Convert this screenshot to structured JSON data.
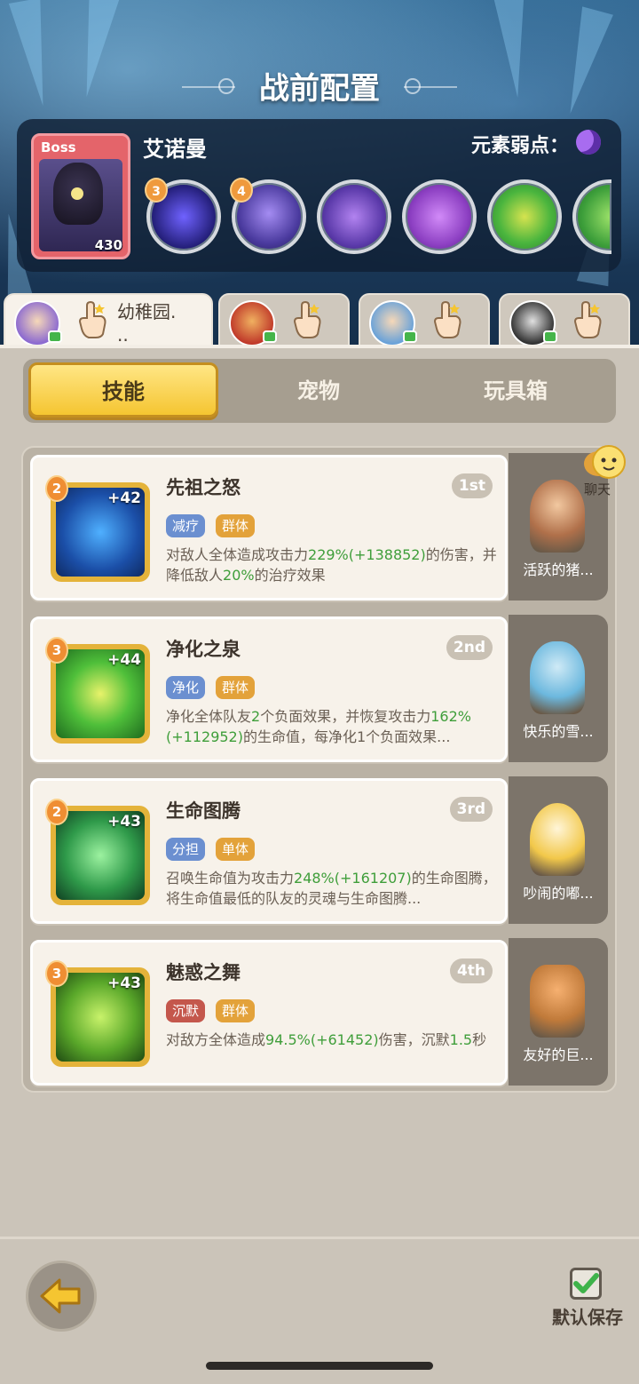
{
  "header": {
    "title": "战前配置"
  },
  "boss": {
    "tag": "Boss",
    "level": "430",
    "name": "艾诺曼",
    "weakness_label": "元素弱点：",
    "weakness_icon": "moon-icon",
    "skill_badges": [
      "3",
      "4"
    ]
  },
  "heroes": [
    {
      "name": "幼稚园.\n..",
      "active": true
    },
    {
      "name": "",
      "active": false
    },
    {
      "name": "",
      "active": false
    },
    {
      "name": "",
      "active": false
    }
  ],
  "tabs": [
    "技能",
    "宠物",
    "玩具箱"
  ],
  "active_tab": "技能",
  "chat": {
    "label": "聊天"
  },
  "skills": [
    {
      "name": "先祖之怒",
      "rank": "1st",
      "level": "2",
      "bonus": "+42",
      "tags": [
        {
          "text": "减疗",
          "color": "#6b8fd0"
        },
        {
          "text": "群体",
          "color": "#e3a23a"
        }
      ],
      "desc_parts": [
        "对敌人全体造成攻击力",
        "229%(+138852)",
        "的伤害，并降低敌人",
        "20%",
        "的治疗效果"
      ],
      "pet": "活跃的猪..."
    },
    {
      "name": "净化之泉",
      "rank": "2nd",
      "level": "3",
      "bonus": "+44",
      "tags": [
        {
          "text": "净化",
          "color": "#6b8fd0"
        },
        {
          "text": "群体",
          "color": "#e3a23a"
        }
      ],
      "desc_parts": [
        "净化全体队友",
        "2",
        "个负面效果，并恢复攻击力",
        "162%(+112952)",
        "的生命值，每净化1个负面效果..."
      ],
      "pet": "快乐的雪..."
    },
    {
      "name": "生命图腾",
      "rank": "3rd",
      "level": "2",
      "bonus": "+43",
      "tags": [
        {
          "text": "分担",
          "color": "#6b8fd0"
        },
        {
          "text": "单体",
          "color": "#e3a23a"
        }
      ],
      "desc_parts": [
        "召唤生命值为攻击力",
        "248%(+161207)",
        "的生命图腾，将生命值最低的队友的灵魂与生命图腾..."
      ],
      "pet": "吵闹的嘟..."
    },
    {
      "name": "魅惑之舞",
      "rank": "4th",
      "level": "3",
      "bonus": "+43",
      "tags": [
        {
          "text": "沉默",
          "color": "#c4574c"
        },
        {
          "text": "群体",
          "color": "#e3a23a"
        }
      ],
      "desc_parts": [
        "对敌方全体造成",
        "94.5%(+61452)",
        "伤害，沉默",
        "1.5",
        "秒"
      ],
      "pet": "友好的巨..."
    }
  ],
  "footer": {
    "save_label": "默认保存"
  }
}
